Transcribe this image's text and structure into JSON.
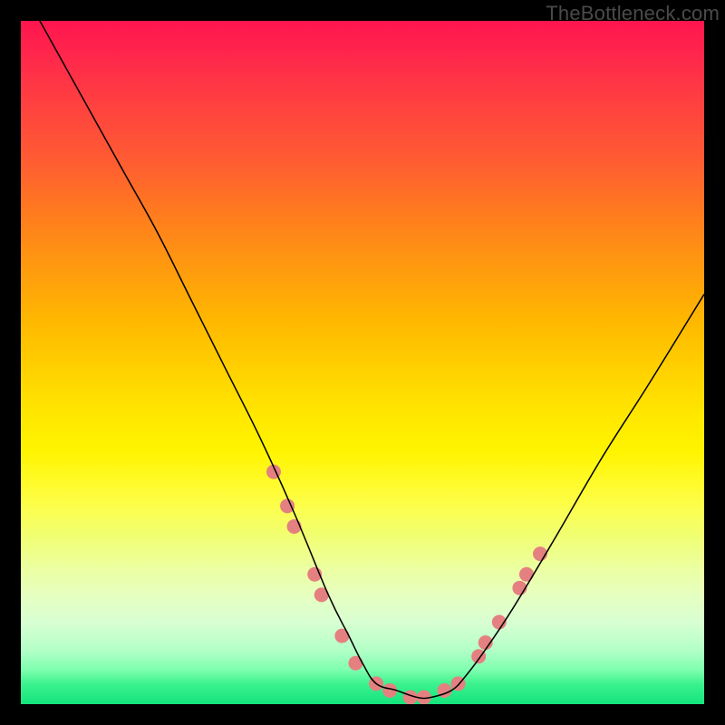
{
  "watermark": "TheBottleneck.com",
  "chart_data": {
    "type": "line",
    "title": "",
    "xlabel": "",
    "ylabel": "",
    "xlim": [
      0,
      100
    ],
    "ylim": [
      0,
      100
    ],
    "grid": false,
    "legend": false,
    "series": [
      {
        "name": "bottleneck-curve",
        "x": [
          0,
          5,
          10,
          15,
          20,
          25,
          30,
          35,
          40,
          45,
          48,
          50,
          52,
          55,
          58,
          60,
          63,
          65,
          68,
          72,
          78,
          85,
          92,
          100
        ],
        "y": [
          105,
          96,
          87,
          78,
          69,
          59,
          49,
          39,
          28,
          16,
          10,
          6,
          3,
          2,
          1,
          1,
          2,
          4,
          8,
          14,
          24,
          36,
          47,
          60
        ],
        "color": "#000000",
        "linewidth": 1.1
      }
    ],
    "markers": {
      "name": "highlight-dots",
      "color": "#e58080",
      "radius": 8,
      "points": [
        {
          "x": 37,
          "y": 34
        },
        {
          "x": 39,
          "y": 29
        },
        {
          "x": 40,
          "y": 26
        },
        {
          "x": 43,
          "y": 19
        },
        {
          "x": 44,
          "y": 16
        },
        {
          "x": 47,
          "y": 10
        },
        {
          "x": 49,
          "y": 6
        },
        {
          "x": 52,
          "y": 3
        },
        {
          "x": 54,
          "y": 2
        },
        {
          "x": 57,
          "y": 1
        },
        {
          "x": 59,
          "y": 1
        },
        {
          "x": 62,
          "y": 2
        },
        {
          "x": 64,
          "y": 3
        },
        {
          "x": 67,
          "y": 7
        },
        {
          "x": 68,
          "y": 9
        },
        {
          "x": 70,
          "y": 12
        },
        {
          "x": 73,
          "y": 17
        },
        {
          "x": 74,
          "y": 19
        },
        {
          "x": 76,
          "y": 22
        }
      ]
    }
  }
}
